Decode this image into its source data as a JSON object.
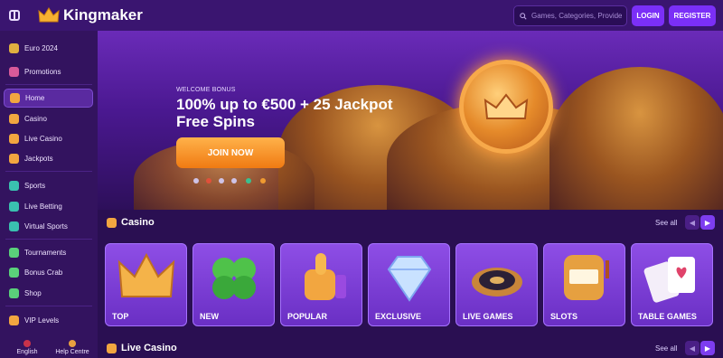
{
  "header": {
    "brand": "Kingmaker",
    "search_placeholder": "Games, Categories, Providers",
    "login_label": "LOGIN",
    "register_label": "REGISTER"
  },
  "sidebar": {
    "items": [
      {
        "label": "Euro 2024",
        "icon": "trophy-icon",
        "color": "#e0b040"
      },
      {
        "label": "Promotions",
        "icon": "gift-icon",
        "color": "#d85a9a"
      },
      {
        "label": "Home",
        "icon": "home-icon",
        "color": "#f2a640"
      },
      {
        "label": "Casino",
        "icon": "slot-icon",
        "color": "#f2a640"
      },
      {
        "label": "Live Casino",
        "icon": "cards-icon",
        "color": "#f2a640"
      },
      {
        "label": "Jackpots",
        "icon": "jackpot-icon",
        "color": "#f2a640"
      },
      {
        "label": "Sports",
        "icon": "soccer-ball-icon",
        "color": "#3ac0b0"
      },
      {
        "label": "Live Betting",
        "icon": "live-betting-icon",
        "color": "#3ac0b0"
      },
      {
        "label": "Virtual Sports",
        "icon": "gamepad-icon",
        "color": "#3ac0b0"
      },
      {
        "label": "Tournaments",
        "icon": "cup-icon",
        "color": "#5ad07a"
      },
      {
        "label": "Bonus Crab",
        "icon": "crab-icon",
        "color": "#5ad07a"
      },
      {
        "label": "Shop",
        "icon": "shop-icon",
        "color": "#5ad07a"
      },
      {
        "label": "VIP Levels",
        "icon": "crown-icon",
        "color": "#f2a640"
      }
    ],
    "active_index": 2,
    "language": "English",
    "help": "Help Centre"
  },
  "banner": {
    "eyebrow": "WELCOME BONUS",
    "headline": "100% up to €500 + 25 Jackpot Free Spins",
    "cta": "JOIN NOW"
  },
  "casino_section": {
    "title": "Casino",
    "see_all": "See all",
    "cards": [
      {
        "label": "TOP",
        "art": "crown-art"
      },
      {
        "label": "NEW",
        "art": "clover-art"
      },
      {
        "label": "POPULAR",
        "art": "thumbs-up-art"
      },
      {
        "label": "EXCLUSIVE",
        "art": "diamond-art"
      },
      {
        "label": "LIVE GAMES",
        "art": "roulette-art"
      },
      {
        "label": "SLOTS",
        "art": "slot-machine-art"
      },
      {
        "label": "TABLE GAMES",
        "art": "playing-cards-art"
      }
    ]
  },
  "live_section": {
    "title": "Live Casino",
    "see_all": "See all"
  },
  "colors": {
    "accent": "#7b2ff7",
    "cta": "#f07a12",
    "background": "#2a0f52"
  }
}
